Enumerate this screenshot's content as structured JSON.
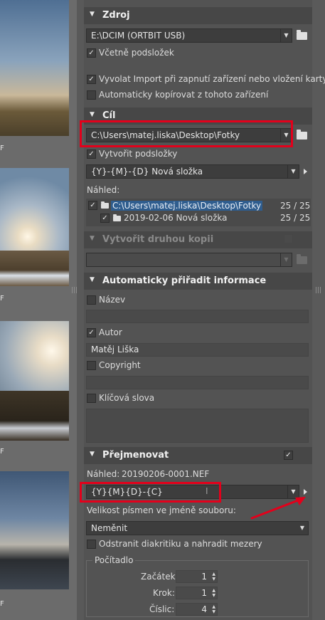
{
  "thumb_labels": [
    "F",
    "F",
    "F",
    "F"
  ],
  "source": {
    "section_title": "Zdroj",
    "path": "E:\\DCIM (ORTBIT USB)",
    "include_subfolders": "Včetně podsložek",
    "invoke_import": "Vyvolat Import při zapnutí zařízení nebo vložení karty",
    "auto_copy": "Automaticky kopírovat z tohoto zařízení"
  },
  "destination": {
    "section_title": "Cíl",
    "path": "C:\\Users\\matej.liska\\Desktop\\Fotky",
    "create_subfolders": "Vytvořit podsložky",
    "subfolder_pattern": "{Y}-{M}-{D} Nová složka",
    "preview_label": "Náhled:",
    "tree": [
      {
        "name": "C:\\Users\\matej.liska\\Desktop\\Fotky",
        "count": "25 / 25"
      },
      {
        "name": "2019-02-06 Nová složka",
        "count": "25 / 25"
      }
    ]
  },
  "second_copy": {
    "section_title": "Vytvořit druhou kopii"
  },
  "auto_info": {
    "section_title": "Automaticky přiřadit informace",
    "name_label": "Název",
    "name_value": "",
    "author_label": "Autor",
    "author_value": "Matěj Liška",
    "copyright_label": "Copyright",
    "copyright_value": "",
    "keywords_label": "Klíčová slova",
    "keywords_value": ""
  },
  "rename": {
    "section_title": "Přejmenovat",
    "preview_label": "Náhled:",
    "preview_value": "20190206-0001.NEF",
    "pattern": "{Y}{M}{D}-{C}",
    "case_label": "Velikost písmen ve jméně souboru:",
    "case_value": "Neměnit",
    "remove_diacritics": "Odstranit diakritiku a nahradit mezery"
  },
  "counter": {
    "title": "Počítadlo",
    "start_label": "Začátek:",
    "start_value": "1",
    "step_label": "Krok:",
    "step_value": "1",
    "digits_label": "Číslic:",
    "digits_value": "4"
  },
  "colors": {
    "highlight": "#e3001b",
    "selection": "#2f5d8e"
  }
}
